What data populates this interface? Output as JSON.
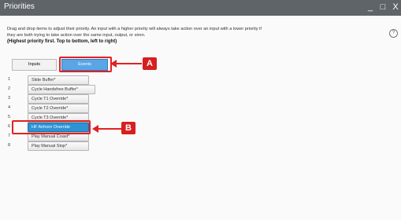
{
  "window": {
    "title": "Priorities",
    "minimize_glyph": "_",
    "maximize_glyph": "□",
    "close_glyph": "X"
  },
  "description": {
    "line1": "Drag and drop items to adjust their priority. An input with a higher priority will always take action over an input with a lower priority if they are both trying to take action over the same input, output, or siren.",
    "line2": "(Highest priority first. Top to bottom, left to right)"
  },
  "help_glyph": "?",
  "tabs": {
    "inputs": "Inputs",
    "events": "Events",
    "selected": "Events"
  },
  "callouts": {
    "a": "A",
    "b": "B"
  },
  "items": [
    {
      "num": "1",
      "label": "Slide Buffer*"
    },
    {
      "num": "2",
      "label": "Cycle Handsfree Buffer*"
    },
    {
      "num": "3",
      "label": "Cycle T1 Override*"
    },
    {
      "num": "4",
      "label": "Cycle T2 Override*"
    },
    {
      "num": "5",
      "label": "Cycle T3 Override*"
    },
    {
      "num": "6",
      "label": "HF Airhorn Override",
      "selected": true
    },
    {
      "num": "7",
      "label": "Play Manual Coast*"
    },
    {
      "num": "8",
      "label": "Play Manual Stop*"
    }
  ],
  "colors": {
    "titlebar": "#5f6469",
    "tab_selected": "#5aa5e6",
    "item_selected": "#2d93d6",
    "annotation_red": "#e32020"
  }
}
